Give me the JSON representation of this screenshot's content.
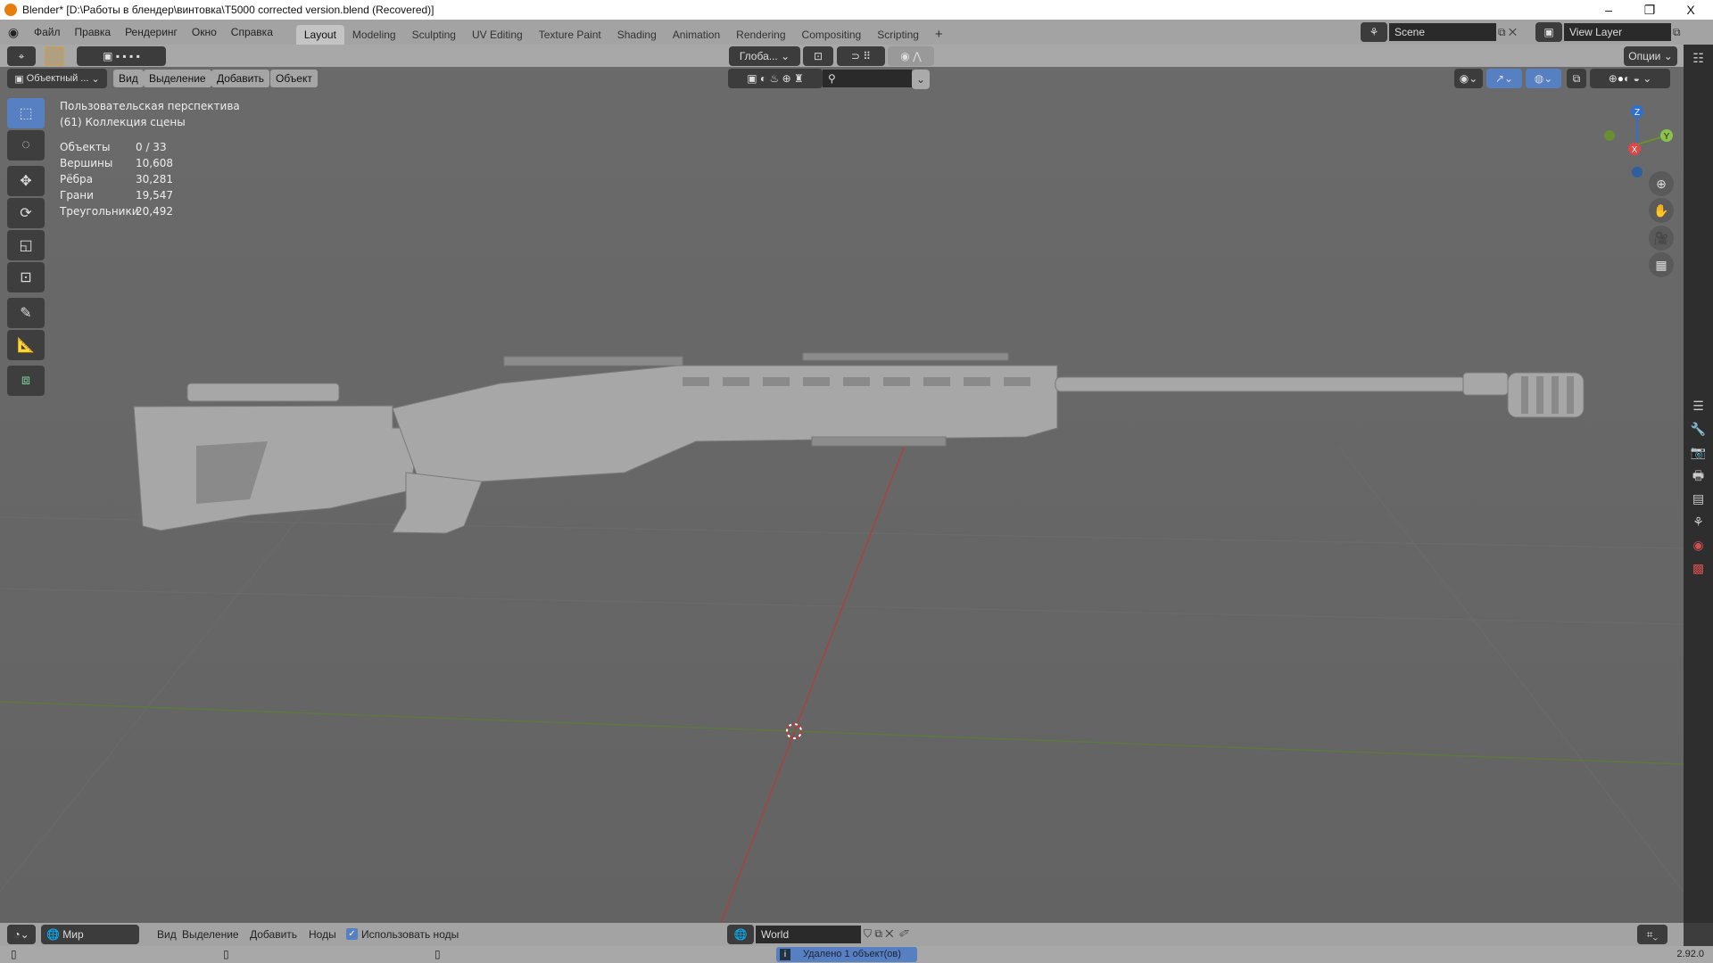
{
  "titlebar": {
    "title": "Blender* [D:\\Работы в блендер\\винтовка\\T5000 corrected version.blend (Recovered)]",
    "minimize": "–",
    "restore": "❐",
    "close": "X"
  },
  "menu": [
    "Файл",
    "Правка",
    "Рендеринг",
    "Окно",
    "Справка"
  ],
  "workspaces": [
    "Layout",
    "Modeling",
    "Sculpting",
    "UV Editing",
    "Texture Paint",
    "Shading",
    "Animation",
    "Rendering",
    "Compositing",
    "Scripting"
  ],
  "add_workspace": "+",
  "scene": {
    "name": "Scene",
    "view_layer": "View Layer"
  },
  "header1": {
    "orientation": "Глоба...",
    "options": "Опции"
  },
  "header2": {
    "mode": "Объектный ...",
    "items": [
      "Вид",
      "Выделение",
      "Добавить",
      "Объект"
    ]
  },
  "overlay": {
    "view": "Пользовательская перспектива",
    "collection": "(61) Коллекция сцены",
    "stats": [
      {
        "k": "Объекты",
        "v": "0 / 33"
      },
      {
        "k": "Вершины",
        "v": "10,608"
      },
      {
        "k": "Рёбра",
        "v": "30,281"
      },
      {
        "k": "Грани",
        "v": "19,547"
      },
      {
        "k": "Треугольники",
        "v": "20,492"
      }
    ]
  },
  "gizmo": {
    "x": "X",
    "y": "Y",
    "z": "Z"
  },
  "bottom": {
    "world_select": "Мир",
    "items": [
      "Вид",
      "Выделение",
      "Добавить",
      "Ноды"
    ],
    "use_nodes": "Использовать ноды",
    "use_nodes_checked": true,
    "world_name": "World"
  },
  "status": {
    "message": "Удалено 1 объект(ов)",
    "version": "2.92.0"
  },
  "colors": {
    "accent": "#5680c2",
    "axis_x": "#c23838",
    "axis_y": "#6a8f2f",
    "axis_z": "#2f6fd0"
  }
}
